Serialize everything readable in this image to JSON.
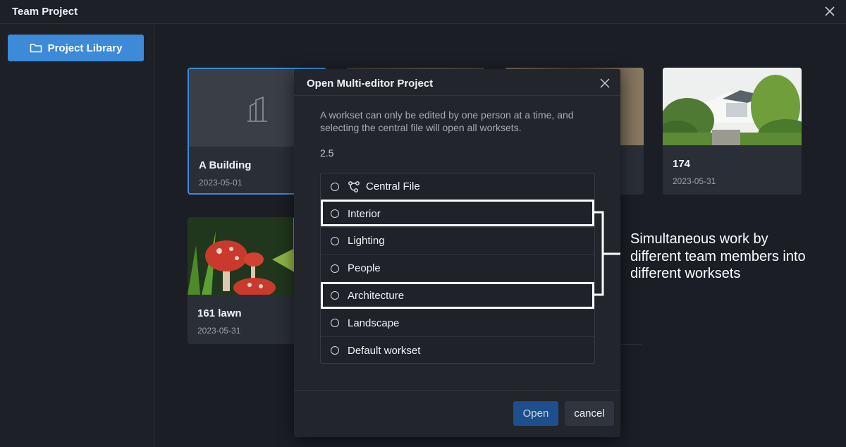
{
  "window": {
    "title": "Team Project"
  },
  "sidebar": {
    "library_button": "Project Library"
  },
  "cards": [
    {
      "name": "A Building",
      "date": "2023-05-01"
    },
    {
      "name": "174",
      "date": "2023-05-31"
    },
    {
      "name": "161 lawn",
      "date": "2023-05-31"
    }
  ],
  "dialog": {
    "title": "Open Multi-editor Project",
    "description": "A workset can only be edited by one person at a time, and selecting the central file will open all worksets.",
    "version": "2.5",
    "worksets": [
      {
        "label": "Central File",
        "icon": "central-file-icon"
      },
      {
        "label": "Interior"
      },
      {
        "label": "Lighting"
      },
      {
        "label": "People"
      },
      {
        "label": "Architecture"
      },
      {
        "label": "Landscape"
      },
      {
        "label": "Default workset"
      }
    ],
    "open_label": "Open",
    "cancel_label": "cancel"
  },
  "annotation": {
    "text": "Simultaneous work by different team members into different worksets"
  },
  "colors": {
    "accent": "#3d8ad8",
    "background": "#1b1e25",
    "highlight": "#ffffff"
  }
}
